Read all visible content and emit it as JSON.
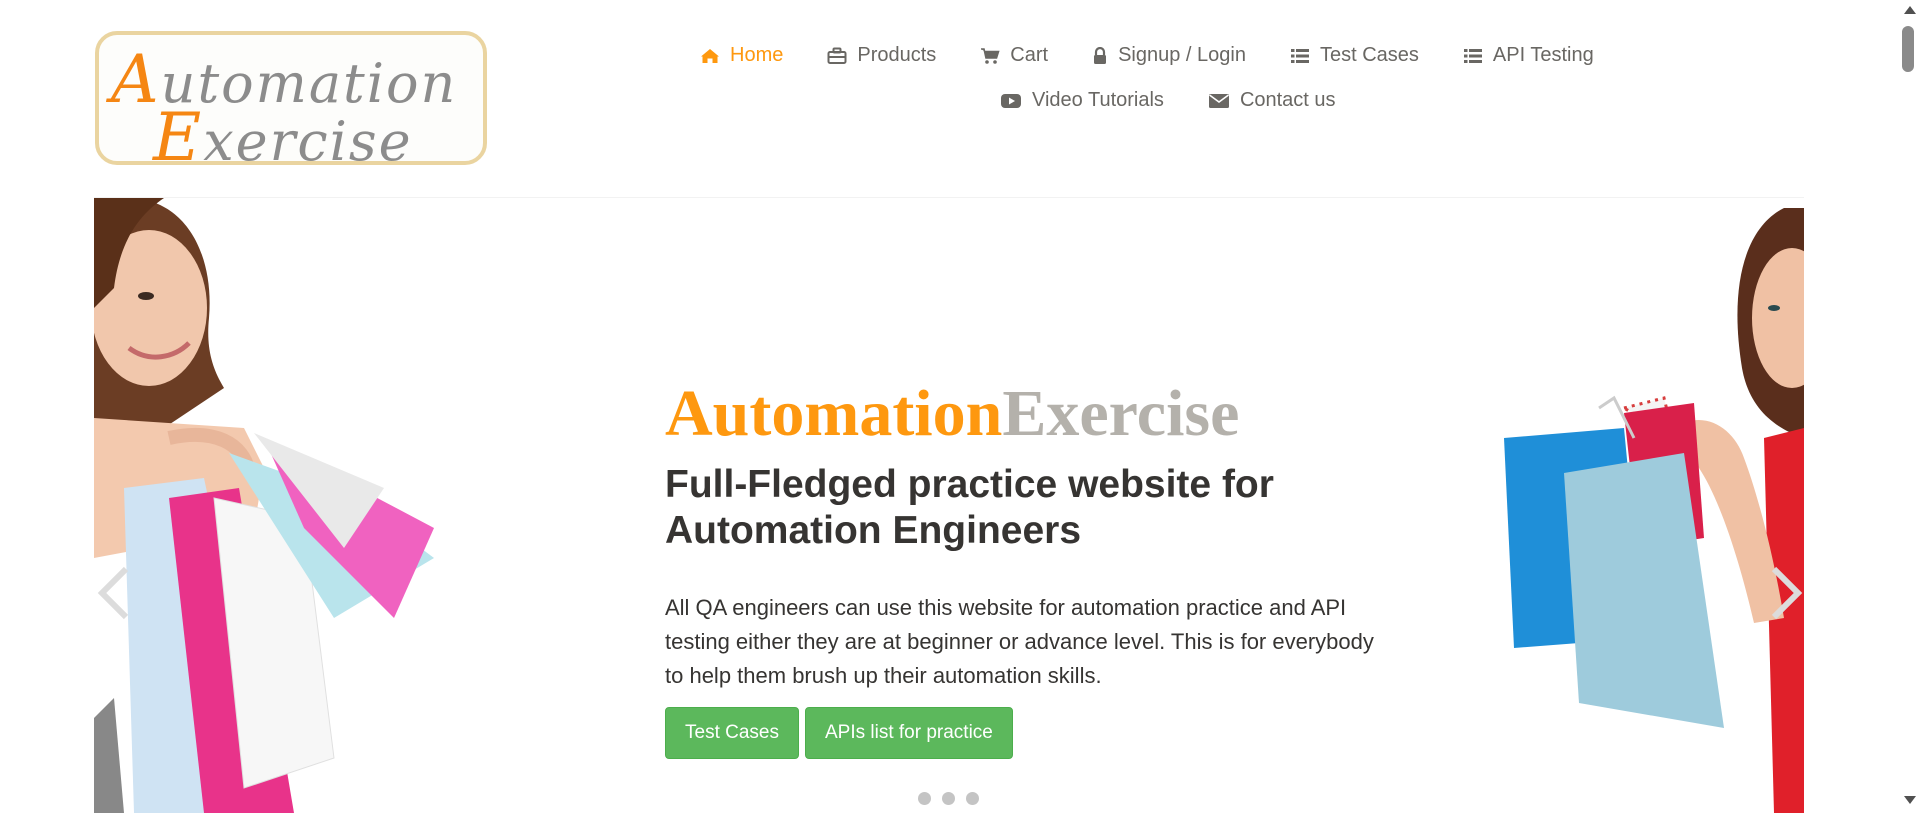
{
  "header": {
    "logo": {
      "line1_cap": "A",
      "line1_rest": "utomation",
      "line2_cap": "E",
      "line2_rest": "xercise"
    },
    "nav": [
      {
        "label": "Home",
        "icon": "home-icon",
        "active": true
      },
      {
        "label": "Products",
        "icon": "briefcase-icon"
      },
      {
        "label": "Cart",
        "icon": "cart-icon"
      },
      {
        "label": "Signup / Login",
        "icon": "lock-icon"
      },
      {
        "label": "Test Cases",
        "icon": "list-icon"
      },
      {
        "label": "API Testing",
        "icon": "list-icon"
      },
      {
        "label": "Video Tutorials",
        "icon": "youtube-play-icon"
      },
      {
        "label": "Contact us",
        "icon": "envelope-icon"
      }
    ]
  },
  "hero": {
    "title_part1": "Automation",
    "title_part2": "Exercise",
    "subtitle": "Full-Fledged practice website for Automation Engineers",
    "description": "All QA engineers can use this website for automation practice and API testing either they are at beginner or advance level. This is for everybody to help them brush up their automation skills.",
    "buttons": [
      "Test Cases",
      "APIs list for practice"
    ],
    "indicator_count": 3
  },
  "colors": {
    "accent": "#fe980f",
    "nav_text": "#696763",
    "button_green": "#5cb85c",
    "title_gray": "#b4b1ab"
  }
}
